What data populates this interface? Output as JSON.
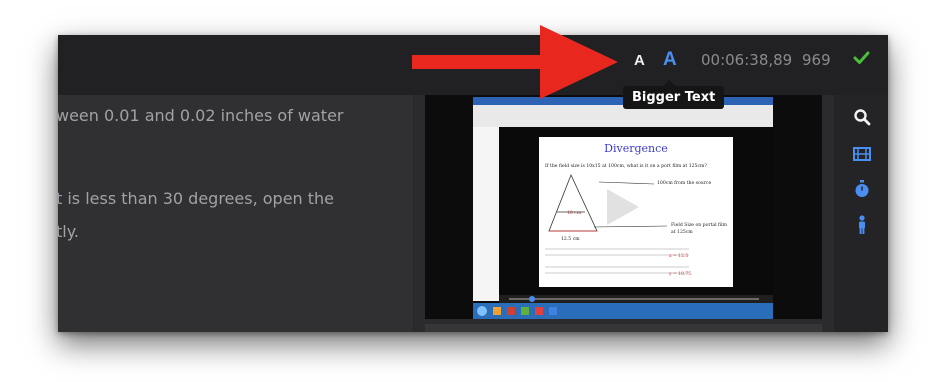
{
  "toolbar": {
    "smaller_text_label": "A",
    "bigger_text_label": "A",
    "timer": "00:06:38,89",
    "count": "969",
    "tooltip": "Bigger Text"
  },
  "text_pane": {
    "line1": "ween 0.01 and 0.02 inches of water",
    "line2": "t is less than 30 degrees, open the",
    "line3": "tly."
  },
  "video_slide": {
    "title": "Divergence",
    "question": "If the field size is 10x15 at 100cm, what is it on a port film at 125cm?",
    "note_source": "100cm from the source",
    "note_field": "Field Size on portal film",
    "note_field2": "at 125cm",
    "label_10": "10 cm",
    "label_125": "12.5 cm"
  },
  "colors": {
    "accent_blue": "#4a8ef2",
    "check_green": "#4cbf3a",
    "arrow_red": "#e8281e"
  },
  "icons": [
    "search-icon",
    "film-icon",
    "stopwatch-icon",
    "person-icon",
    "check-icon"
  ]
}
